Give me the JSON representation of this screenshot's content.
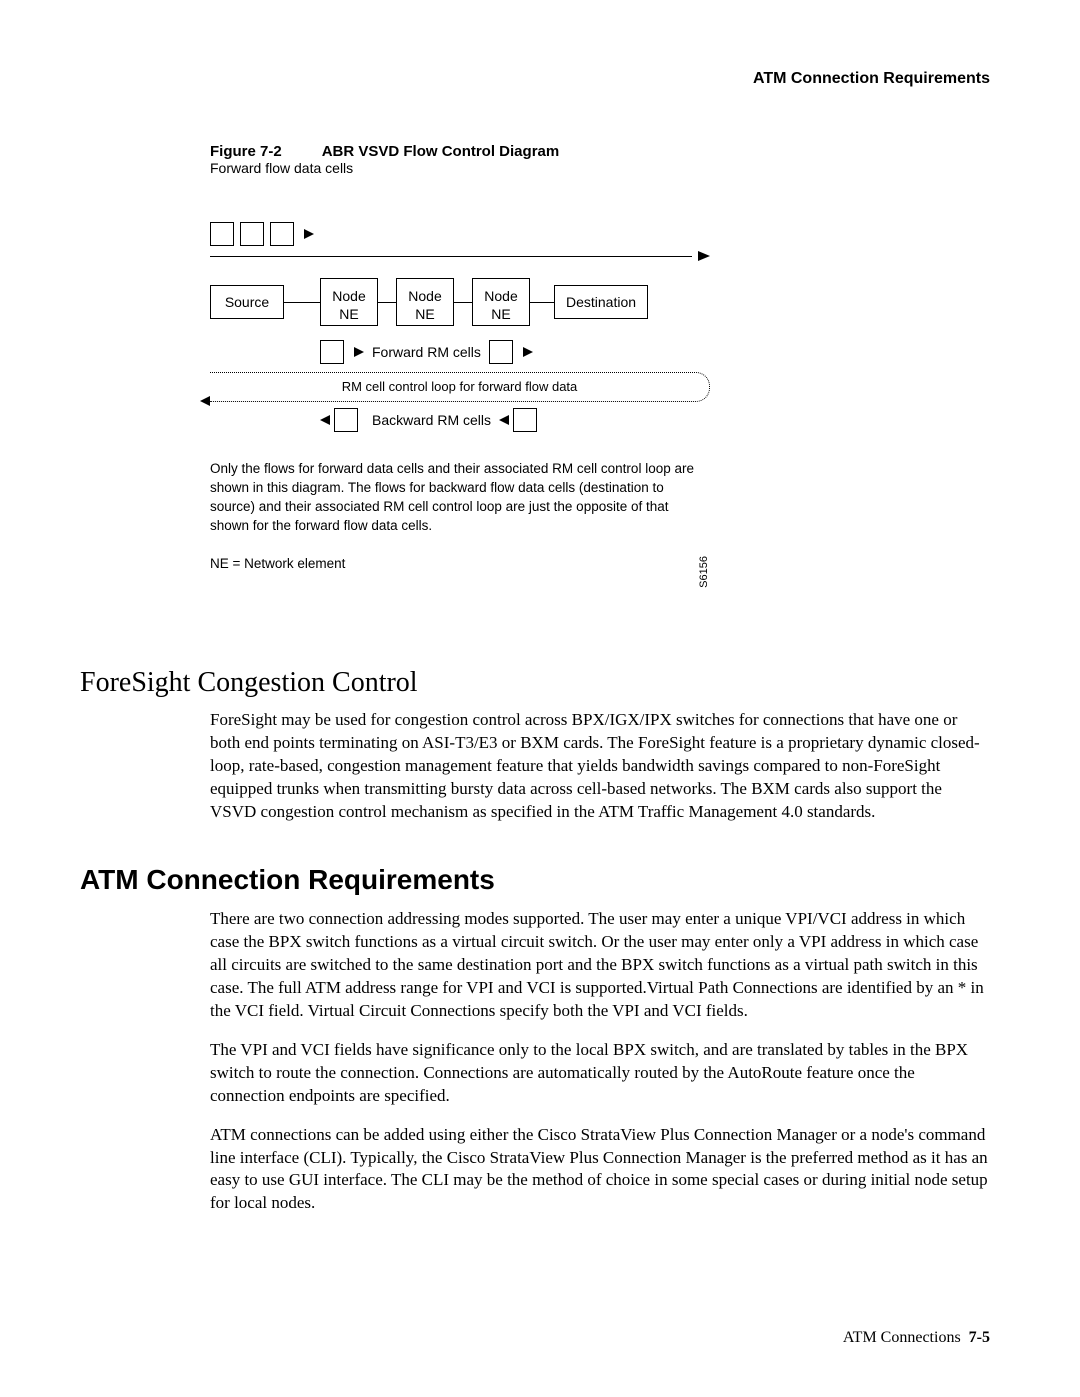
{
  "header": {
    "running_title": "ATM Connection Requirements"
  },
  "figure": {
    "label": "Figure 7-2",
    "title": "ABR VSVD Flow Control Diagram",
    "forward_data_label": "Forward flow data cells",
    "source_label": "Source",
    "node_top": "Node",
    "node_bottom": "NE",
    "destination_label": "Destination",
    "forward_rm_label": "Forward RM cells",
    "loop_label": "RM cell control loop for forward flow data",
    "backward_rm_label": "Backward RM cells",
    "caption": "Only the flows for forward data cells and their associated RM cell control loop are shown in this diagram. The flows for backward flow data cells (destination to source) and their associated RM cell control loop are just the opposite of that shown for the forward flow data cells.",
    "ne_legend": "NE = Network element",
    "figure_id": "S6156"
  },
  "section_foresight": {
    "heading": "ForeSight Congestion Control",
    "para": "ForeSight may be used for congestion control across BPX/IGX/IPX switches for connections that have one or both end points terminating on ASI-T3/E3 or BXM cards. The ForeSight feature is a proprietary dynamic closed-loop, rate-based, congestion management feature that yields bandwidth savings compared to non-ForeSight equipped trunks when transmitting bursty data across cell-based networks. The BXM cards also support the VSVD congestion control mechanism as specified in the ATM Traffic Management 4.0 standards."
  },
  "section_atm": {
    "heading": "ATM Connection Requirements",
    "para1": "There are two connection addressing modes supported. The user may enter a unique VPI/VCI address in which case the BPX switch functions as a virtual circuit switch. Or the user may enter only a VPI address in which case all circuits are switched to the same destination port and the BPX switch functions as a virtual path switch in this case. The full ATM address range for VPI and VCI is supported.Virtual Path Connections are identified by an * in the VCI field. Virtual Circuit Connections specify both the VPI and VCI fields.",
    "para2": "The VPI and VCI fields have significance only to the local BPX switch, and are translated by tables in the BPX switch to route the connection. Connections are automatically routed by the AutoRoute feature once the connection endpoints are specified.",
    "para3": "ATM connections can be added using either the Cisco StrataView Plus Connection Manager or a node's command line interface (CLI). Typically, the Cisco StrataView Plus Connection Manager is the preferred method as it has an easy to use GUI interface. The CLI may be the method of choice in some special cases or during initial node setup for local nodes."
  },
  "footer": {
    "chapter": "ATM Connections",
    "pagenum": "7-5"
  }
}
